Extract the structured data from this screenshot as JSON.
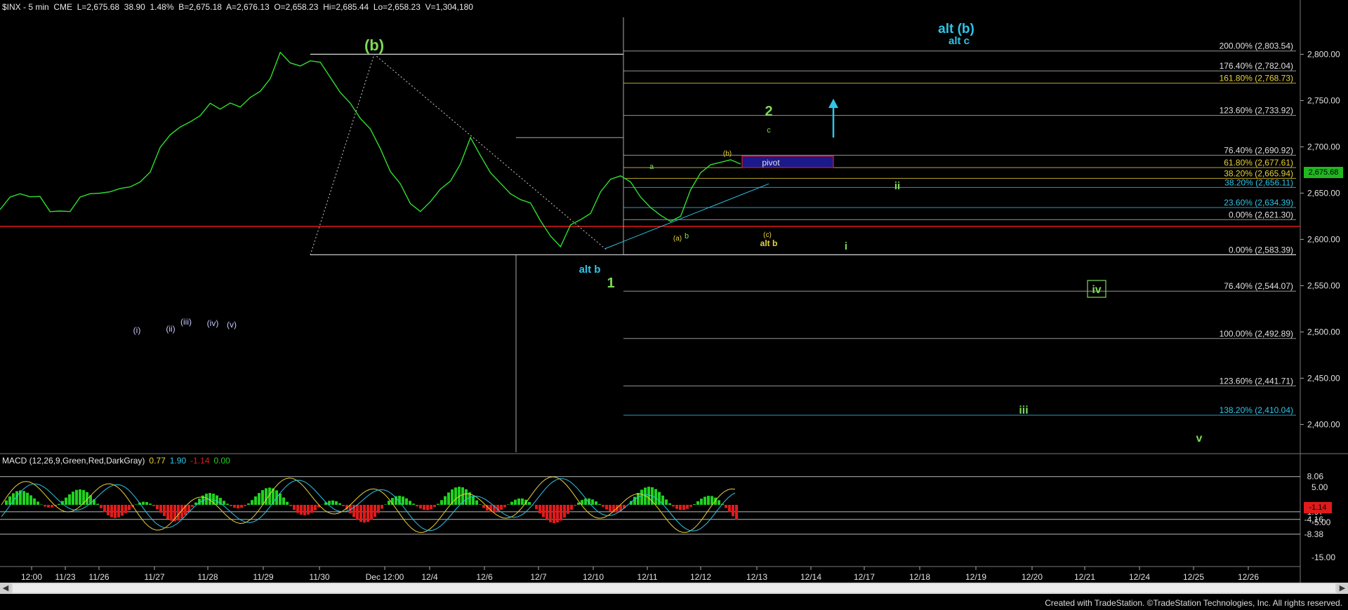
{
  "header": {
    "symbol": "$INX - 5 min",
    "exchange": "CME",
    "last": "L=2,675.68",
    "change": "38.90",
    "change_pct": "1.48%",
    "bid": "B=2,675.18",
    "ask": "A=2,676.13",
    "open": "O=2,658.23",
    "high": "Hi=2,685.44",
    "low": "Lo=2,658.23",
    "volume": "V=1,304,180"
  },
  "last_price_tag": "2,675.68",
  "macd_header": {
    "label": "MACD (12,26,9,Green,Red,DarkGray)",
    "v1": "0.77",
    "v2": "1.90",
    "v3": "-1.14",
    "v4": "0.00"
  },
  "macd_value_tag": "-1.14",
  "credit": "Created with TradeStation. ©TradeStation Technologies, Inc. All rights reserved.",
  "colors": {
    "price": "#2fdf2f",
    "wave_green": "#7ed957",
    "cyan": "#2ec5e8",
    "yellow": "#e8d23a",
    "red_line": "#e01b1b",
    "white": "#e0e0e0",
    "macd_pos": "#1fd21f",
    "macd_neg": "#e01b1b"
  },
  "chart_data": {
    "type": "line",
    "title": "$INX - 5 min",
    "ylim": [
      2370,
      2845
    ],
    "yticks": [
      2400,
      2450,
      2500,
      2550,
      2600,
      2650,
      2700,
      2750,
      2800
    ],
    "ytick_labels": [
      "2,400.00",
      "2,450.00",
      "2,500.00",
      "2,550.00",
      "2,600.00",
      "2,650.00",
      "2,700.00",
      "2,750.00",
      "2,800.00"
    ],
    "xticks": [
      "12:00",
      "11/23",
      "11/26",
      "11/27",
      "11/28",
      "11/29",
      "11/30",
      "Dec 12:00",
      "12/4",
      "12/6",
      "12/7",
      "12/10",
      "12/11",
      "12/12",
      "12/13",
      "12/14",
      "12/17",
      "12/18",
      "12/19",
      "12/20",
      "12/21",
      "12/24",
      "12/25",
      "12/26"
    ],
    "series": [
      {
        "values": [
          2630,
          2645,
          2650,
          2648,
          2645,
          2630,
          2632,
          2628,
          2645,
          2650,
          2652,
          2650,
          2655,
          2658,
          2660,
          2672,
          2700,
          2715,
          2720,
          2727,
          2735,
          2745,
          2740,
          2748,
          2745,
          2752,
          2760,
          2775,
          2800,
          2790,
          2788,
          2795,
          2790,
          2775,
          2760,
          2745,
          2730,
          2720,
          2700,
          2672,
          2660,
          2640,
          2628,
          2640,
          2655,
          2665,
          2680,
          2710,
          2692,
          2670,
          2660,
          2650,
          2645,
          2638,
          2620,
          2605,
          2590,
          2615,
          2622,
          2630,
          2650,
          2665,
          2670,
          2660,
          2645,
          2635,
          2628,
          2618,
          2625,
          2655,
          2670,
          2680,
          2684,
          2688,
          2680
        ]
      }
    ],
    "fib_levels_right": [
      {
        "label": "200.00% (2,803.54)",
        "value": 2803.54,
        "color": "#e0e0e0"
      },
      {
        "label": "176.40% (2,782.04)",
        "value": 2782.04,
        "color": "#e0e0e0"
      },
      {
        "label": "161.80% (2,768.73)",
        "value": 2768.73,
        "color": "#e8d23a"
      },
      {
        "label": "123.60% (2,733.92)",
        "value": 2733.92,
        "color": "#e0e0e0"
      },
      {
        "label": "76.40% (2,690.92)",
        "value": 2690.92,
        "color": "#e0e0e0"
      },
      {
        "label": "61.80% (2,677.61)",
        "value": 2677.61,
        "color": "#e8d23a"
      },
      {
        "label": "38.20% (2,665.94)",
        "value": 2665.94,
        "color": "#e8d23a"
      },
      {
        "label": "38.20% (2,656.11)",
        "value": 2656.11,
        "color": "#2ec5e8"
      },
      {
        "label": "23.60% (2,634.39)",
        "value": 2634.39,
        "color": "#2ec5e8"
      },
      {
        "label": "0.00% (2,621.30)",
        "value": 2621.3,
        "color": "#e0e0e0"
      },
      {
        "label": "0.00% (2,583.39)",
        "value": 2583.39,
        "color": "#e0e0e0"
      },
      {
        "label": "76.40% (2,544.07)",
        "value": 2544.07,
        "color": "#e0e0e0"
      },
      {
        "label": "100.00% (2,492.89)",
        "value": 2492.89,
        "color": "#e0e0e0"
      },
      {
        "label": "123.60% (2,441.71)",
        "value": 2441.71,
        "color": "#e0e0e0"
      },
      {
        "label": "138.20% (2,410.04)",
        "value": 2410.04,
        "color": "#2ec5e8"
      }
    ],
    "horizontal_lines": [
      2621.3,
      2614.0
    ],
    "wave_labels": [
      {
        "text": "(b)",
        "color": "#7ed957"
      },
      {
        "text": "alt (b)",
        "color": "#2ec5e8"
      },
      {
        "text": "alt c",
        "color": "#2ec5e8"
      },
      {
        "text": "2",
        "color": "#7ed957"
      },
      {
        "text": "c",
        "color": "#7ed957"
      },
      {
        "text": "1",
        "color": "#7ed957"
      },
      {
        "text": "alt b",
        "color": "#2ec5e8"
      },
      {
        "text": "a",
        "color": "#7ed957"
      },
      {
        "text": "b",
        "color": "#7ed957"
      },
      {
        "text": "(a)",
        "color": "#e8d23a"
      },
      {
        "text": "(b)",
        "color": "#e8d23a"
      },
      {
        "text": "(c)",
        "color": "#e8d23a"
      },
      {
        "text": "alt b",
        "color": "#e8d23a"
      },
      {
        "text": "ii",
        "color": "#7ed957"
      },
      {
        "text": "i",
        "color": "#7ed957"
      },
      {
        "text": "iii",
        "color": "#7ed957"
      },
      {
        "text": "iv",
        "color": "#7ed957"
      },
      {
        "text": "v",
        "color": "#7ed957"
      },
      {
        "text": "(i)",
        "color": "#c8c8ff"
      },
      {
        "text": "(ii)",
        "color": "#c8c8ff"
      },
      {
        "text": "(iii)",
        "color": "#c8c8ff"
      },
      {
        "text": "(iv)",
        "color": "#c8c8ff"
      },
      {
        "text": "(v)",
        "color": "#c8c8ff"
      },
      {
        "text": "pivot",
        "color": "#e0e0e0"
      }
    ],
    "macd": {
      "levels": [
        8.06,
        -1.97,
        -4.16,
        -8.38
      ],
      "level_labels": [
        "8.06",
        "-1.97",
        "-4.16",
        "-8.38"
      ],
      "yticks": [
        5.0,
        -5.0,
        -15.0
      ],
      "ytick_labels": [
        "5.00",
        "-5.00",
        "-15.00"
      ]
    }
  }
}
